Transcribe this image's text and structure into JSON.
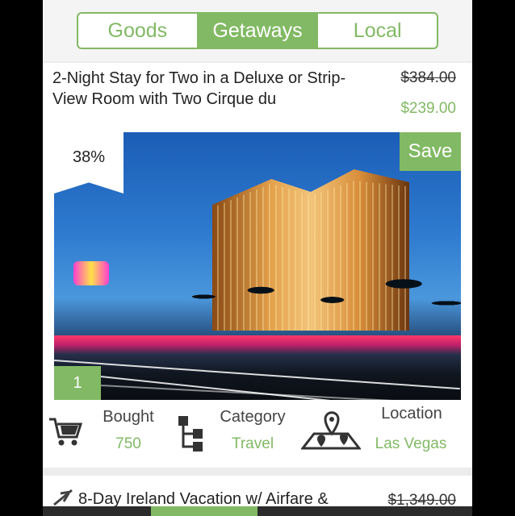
{
  "tabs": [
    {
      "label": "Goods",
      "active": false
    },
    {
      "label": "Getaways",
      "active": true
    },
    {
      "label": "Local",
      "active": false
    }
  ],
  "deal": {
    "title": "2-Night Stay for Two in a Deluxe or Strip-View Room with Two Cirque du",
    "old_price": "$384.00",
    "new_price": "$239.00",
    "discount": "38%",
    "save_label": "Save",
    "image_index": "1",
    "stats": {
      "bought_label": "Bought",
      "bought_value": "750",
      "category_label": "Category",
      "category_value": "Travel",
      "location_label": "Location",
      "location_value": "Las Vegas"
    }
  },
  "next_deal": {
    "title": "8-Day Ireland Vacation w/ Airfare &",
    "old_price": "$1,349.00"
  },
  "colors": {
    "accent": "#82b964",
    "background": "#ececec"
  },
  "icons": [
    "cart-icon",
    "category-tree-icon",
    "map-pins-icon",
    "airplane-icon"
  ]
}
